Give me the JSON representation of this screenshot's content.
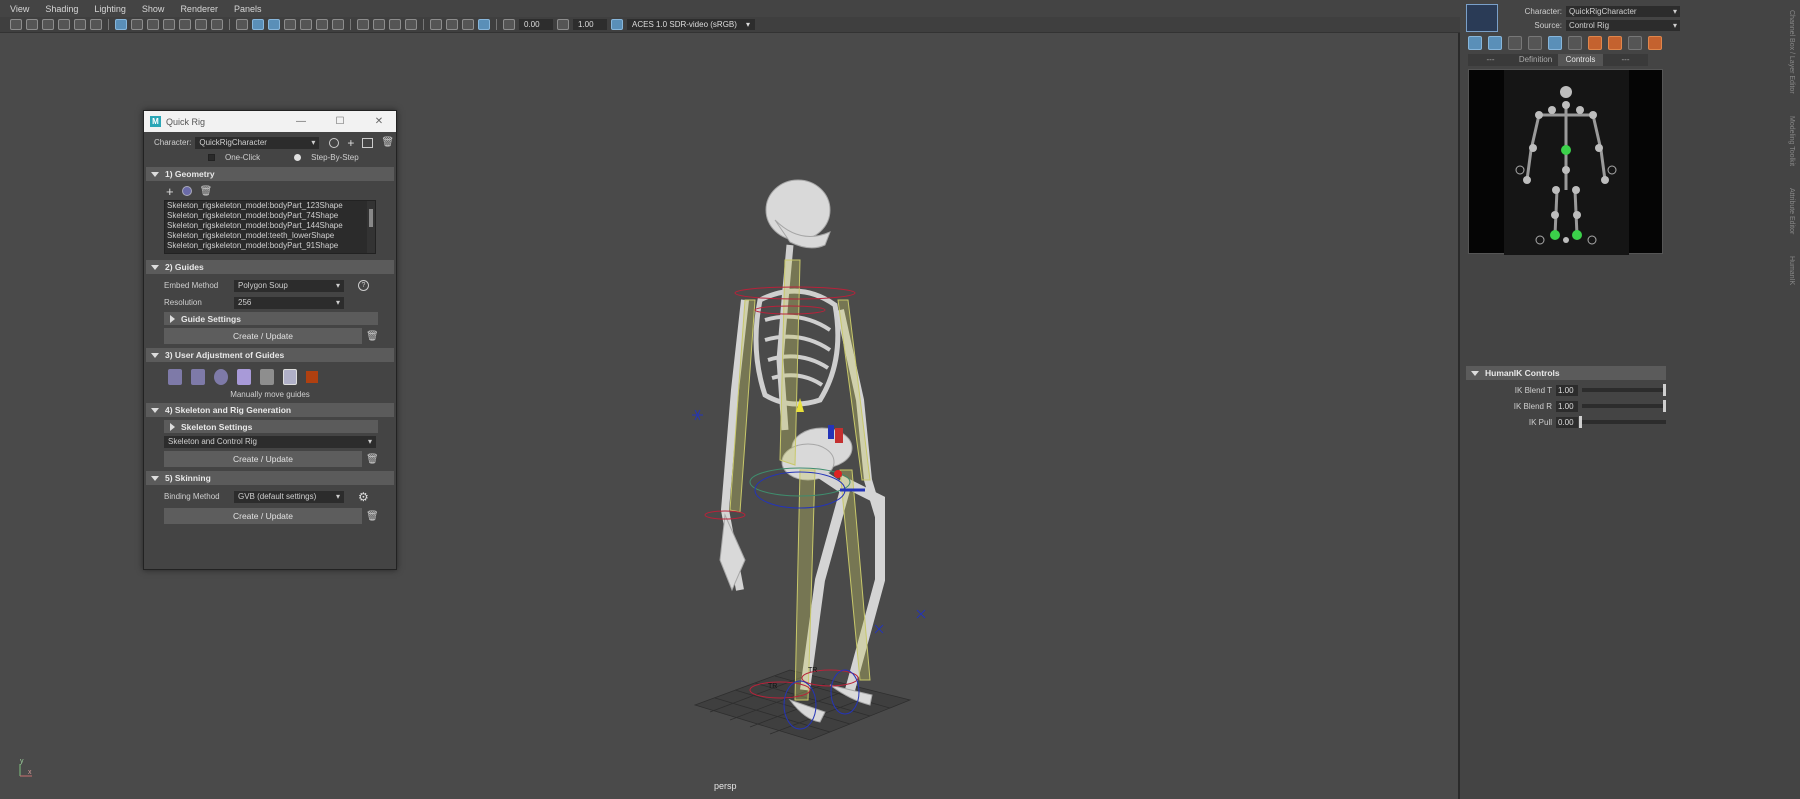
{
  "viewport": {
    "menu": [
      "View",
      "Shading",
      "Lighting",
      "Show",
      "Renderer",
      "Panels"
    ],
    "toolbar": {
      "value1": "0.00",
      "value2": "1.00",
      "color_space": "ACES 1.0 SDR-video (sRGB)"
    },
    "camera_label": "persp",
    "axis": {
      "y": "y",
      "x": "x"
    }
  },
  "quick_rig": {
    "title": "Quick Rig",
    "character_label": "Character:",
    "character_value": "QuickRigCharacter",
    "mode_one_click": "One-Click",
    "mode_step_by_step": "Step-By-Step",
    "sections": {
      "geometry": "1) Geometry",
      "guides": "2) Guides",
      "user_adjust": "3) User Adjustment of Guides",
      "skeleton_rig": "4) Skeleton and Rig Generation",
      "skinning": "5) Skinning"
    },
    "geometry_list": [
      "Skeleton_rigskeleton_model:bodyPart_123Shape",
      "Skeleton_rigskeleton_model:bodyPart_74Shape",
      "Skeleton_rigskeleton_model:bodyPart_144Shape",
      "Skeleton_rigskeleton_model:teeth_lowerShape",
      "Skeleton_rigskeleton_model:bodyPart_91Shape"
    ],
    "embed_method_label": "Embed Method",
    "embed_method_value": "Polygon Soup",
    "resolution_label": "Resolution",
    "resolution_value": "256",
    "guide_settings": "Guide Settings",
    "create_update": "Create / Update",
    "manually_move": "Manually move guides",
    "skeleton_settings": "Skeleton Settings",
    "skeleton_dd": "Skeleton and Control Rig",
    "binding_method_label": "Binding Method",
    "binding_method_value": "GVB (default settings)"
  },
  "humanik": {
    "character_label": "Character:",
    "character_value": "QuickRigCharacter",
    "source_label": "Source:",
    "source_value": "Control Rig",
    "tabs": [
      "---",
      "Definition",
      "Controls",
      "---"
    ],
    "controls_title": "HumanIK Controls",
    "sliders": [
      {
        "label": "IK Blend T",
        "value": "1.00",
        "fraction": 1.0
      },
      {
        "label": "IK Blend R",
        "value": "1.00",
        "fraction": 1.0
      },
      {
        "label": "IK Pull",
        "value": "0.00",
        "fraction": 0.0
      }
    ],
    "side_tabs": [
      "Channel Box / Layer Editor",
      "Modeling Toolkit",
      "Attribute Editor",
      "HumanIK"
    ]
  }
}
